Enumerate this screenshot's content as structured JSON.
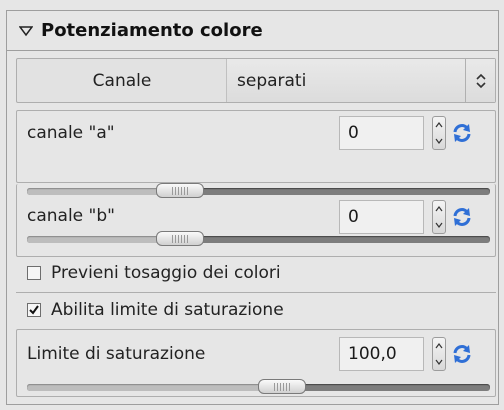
{
  "panel": {
    "title": "Potenziamento colore"
  },
  "channel": {
    "label": "Canale",
    "value": "separati"
  },
  "channel_a": {
    "label": "canale \"a\"",
    "value": "0",
    "slider_fraction": 0.33
  },
  "channel_b": {
    "label": "canale \"b\"",
    "value": "0",
    "slider_fraction": 0.33
  },
  "prevent_clipping": {
    "label": "Previeni tosaggio dei colori",
    "checked": false
  },
  "enable_saturation_limit": {
    "label": "Abilita limite di saturazione",
    "checked": true
  },
  "saturation_limit": {
    "label": "Limite di saturazione",
    "value": "100,0",
    "slider_fraction": 0.55
  },
  "icons": {
    "collapse": "triangle-down-icon",
    "combo": "up-down-arrows-icon",
    "reset": "reset-refresh-icon"
  },
  "colors": {
    "reset_icon": "#2f6fd6"
  }
}
